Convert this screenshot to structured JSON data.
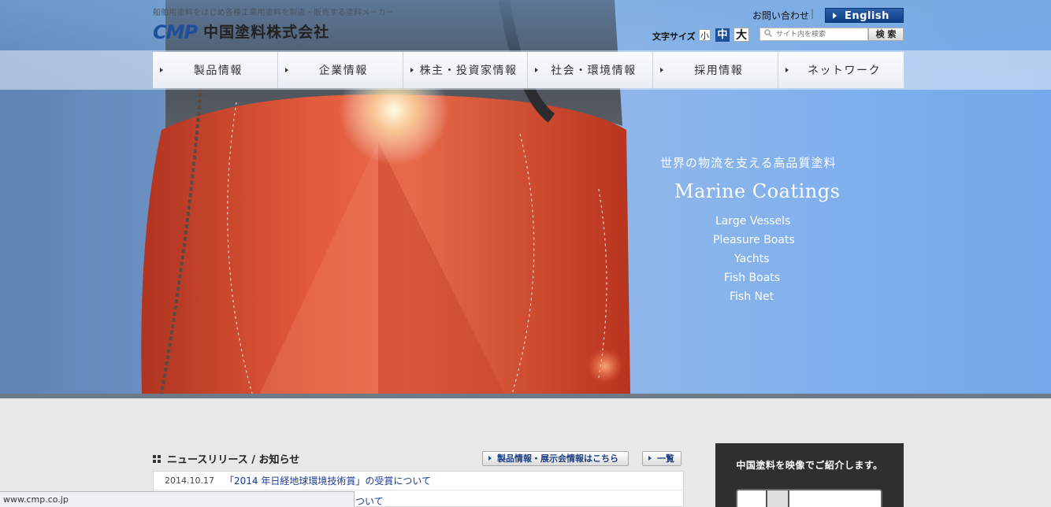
{
  "header": {
    "tagline": "船舶用塗料をはじめ各種工業用塗料を製造・販売する塗料メーカー",
    "logo_mark": "CMP",
    "company_name": "中国塗料株式会社",
    "inquiry_label": "お問い合わせ",
    "separator": "|",
    "english_label": "English",
    "font_size_label": "文字サイズ",
    "font_small": "小",
    "font_medium": "中",
    "font_large": "大",
    "search_placeholder": "サイト内を検索",
    "search_button": "検 索"
  },
  "nav": {
    "items": [
      {
        "label": "製品情報"
      },
      {
        "label": "企業情報"
      },
      {
        "label": "株主・投資家情報"
      },
      {
        "label": "社会・環境情報"
      },
      {
        "label": "採用情報"
      },
      {
        "label": "ネットワーク"
      }
    ]
  },
  "hero": {
    "subtitle": "世界の物流を支える高品質塗料",
    "title": "Marine Coatings",
    "items": [
      "Large Vessels",
      "Pleasure Boats",
      "Yachts",
      "Fish Boats",
      "Fish Net"
    ]
  },
  "news": {
    "heading": "ニュースリリース / お知らせ",
    "products_button": "製品情報・展示会情報はこちら",
    "list_button": "一覧",
    "rows": [
      {
        "date": "2014.10.17",
        "title": "「2014 年日経地球環境技術賞」の受賞について"
      },
      {
        "date": "",
        "title": "ついて"
      }
    ]
  },
  "video": {
    "title": "中国塗料を映像でご紹介します。"
  },
  "statusbar": {
    "url": "www.cmp.co.jp"
  },
  "colors": {
    "brand_blue": "#1d4f9c",
    "hull_red": "#d8462c",
    "link_blue": "#1a3a9a"
  }
}
